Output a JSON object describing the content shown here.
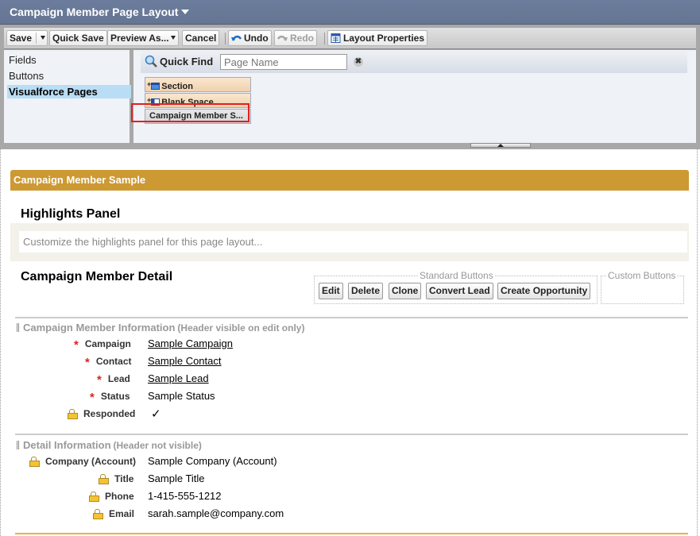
{
  "titlebar": {
    "title": "Campaign Member Page Layout"
  },
  "toolbar": {
    "save": "Save",
    "quick_save": "Quick Save",
    "preview_as": "Preview As...",
    "cancel": "Cancel",
    "undo": "Undo",
    "redo": "Redo",
    "layout_properties": "Layout Properties"
  },
  "palette": {
    "categories": [
      {
        "label": "Fields",
        "active": false
      },
      {
        "label": "Buttons",
        "active": false
      },
      {
        "label": "Visualforce Pages",
        "active": true
      }
    ],
    "quick_find": {
      "label": "Quick Find",
      "placeholder": "Page Name",
      "value": ""
    },
    "items": [
      {
        "label": "Section",
        "icon": "section-icon"
      },
      {
        "label": "Blank Space",
        "icon": "blank-space-icon"
      },
      {
        "label": "Campaign Member S...",
        "icon": ""
      }
    ]
  },
  "layout": {
    "header": "Campaign Member Sample",
    "highlights_panel": {
      "title": "Highlights Panel",
      "placeholder": "Customize the highlights panel for this page layout..."
    },
    "detail": {
      "title": "Campaign Member Detail",
      "standard_buttons_label": "Standard Buttons",
      "custom_buttons_label": "Custom Buttons",
      "standard_buttons": [
        "Edit",
        "Delete",
        "Clone",
        "Convert Lead",
        "Create Opportunity"
      ]
    },
    "sections": [
      {
        "title": "Campaign Member Information",
        "note": "(Header visible on edit only)",
        "fields": [
          {
            "label": "Campaign",
            "value": "Sample Campaign",
            "marker": "required",
            "link": true
          },
          {
            "label": "Contact",
            "value": "Sample Contact",
            "marker": "required",
            "link": true
          },
          {
            "label": "Lead",
            "value": "Sample Lead",
            "marker": "required",
            "link": true
          },
          {
            "label": "Status",
            "value": "Sample Status",
            "marker": "required",
            "link": false
          },
          {
            "label": "Responded",
            "value": "✓",
            "marker": "lock",
            "link": false
          }
        ]
      },
      {
        "title": "Detail Information",
        "note": "(Header not visible)",
        "fields": [
          {
            "label": "Company (Account)",
            "value": "Sample Company (Account)",
            "marker": "lock",
            "link": false
          },
          {
            "label": "Title",
            "value": "Sample Title",
            "marker": "lock",
            "link": false
          },
          {
            "label": "Phone",
            "value": "1-415-555-1212",
            "marker": "lock",
            "link": false
          },
          {
            "label": "Email",
            "value": "sarah.sample@company.com",
            "marker": "lock",
            "link": false
          }
        ]
      }
    ]
  },
  "colors": {
    "titlebar": "#6c7c9c",
    "layout_header": "#cc9933",
    "palette_item": "#efd2ae",
    "active_category": "#b8ddf5",
    "required": "#e02020",
    "selection_outline": "#e02020"
  }
}
